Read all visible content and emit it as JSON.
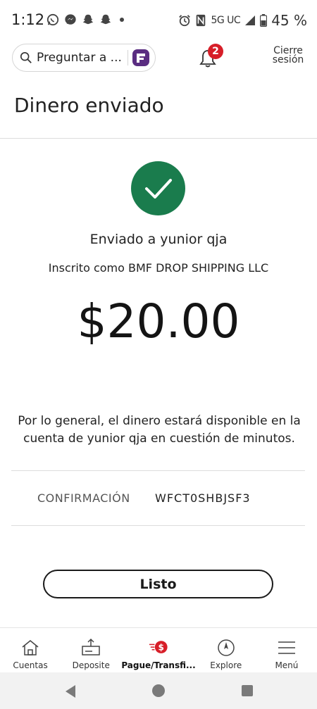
{
  "status_bar": {
    "time": "1:12",
    "network": "5G UC",
    "battery": "45 %",
    "app_icons": [
      "whatsapp-icon",
      "messenger-icon",
      "snapchat-icon",
      "snapchat-icon"
    ]
  },
  "header": {
    "search_label": "Preguntar a ...",
    "notification_count": "2",
    "signout_label": "Cierre sesión"
  },
  "page": {
    "title": "Dinero enviado"
  },
  "confirmation": {
    "sent_to": "Enviado a yunior qja",
    "enrolled_as": "Inscrito como BMF DROP SHIPPING LLC",
    "amount": "$20.00",
    "availability_note": "Por lo general, el dinero estará disponible en la cuenta de yunior qja en cuestión de minutos.",
    "confirmation_label": "CONFIRMACIÓN",
    "confirmation_number": "WFCT0SHBJSF3"
  },
  "actions": {
    "done_label": "Listo"
  },
  "bottom_nav": {
    "items": [
      {
        "label": "Cuentas",
        "icon": "home-icon"
      },
      {
        "label": "Deposite",
        "icon": "deposit-icon"
      },
      {
        "label": "Pague/Transfi...",
        "icon": "pay-transfer-icon"
      },
      {
        "label": "Explore",
        "icon": "compass-icon"
      },
      {
        "label": "Menú",
        "icon": "menu-icon"
      }
    ]
  },
  "colors": {
    "success_green": "#1a7c4d",
    "badge_red": "#d71e28",
    "logo_purple": "#5a2d81"
  }
}
